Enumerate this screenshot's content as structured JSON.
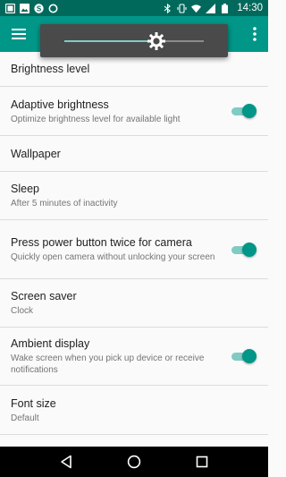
{
  "status_bar": {
    "time": "14:30",
    "left_icons": [
      "notification-icon",
      "image-icon",
      "skype-icon",
      "sync-icon"
    ],
    "right_icons": [
      "bluetooth-icon",
      "vibrate-icon",
      "wifi-icon",
      "cellular-icon",
      "battery-icon"
    ]
  },
  "toolbar": {
    "color": "#009688",
    "menu_icon": "hamburger-menu-icon",
    "overflow_icon": "more-vert-icon"
  },
  "brightness_slider": {
    "level": 0.66,
    "icon": "brightness-icon"
  },
  "settings": [
    {
      "title": "Brightness level",
      "summary": "",
      "toggle": null
    },
    {
      "title": "Adaptive brightness",
      "summary": "Optimize brightness level for available light",
      "toggle": true
    },
    {
      "title": "Wallpaper",
      "summary": "",
      "toggle": null
    },
    {
      "title": "Sleep",
      "summary": "After 5 minutes of inactivity",
      "toggle": null
    },
    {
      "title": "Press power button twice for camera",
      "summary": "Quickly open camera without unlocking your screen",
      "toggle": true
    },
    {
      "title": "Screen saver",
      "summary": "Clock",
      "toggle": null
    },
    {
      "title": "Ambient display",
      "summary": "Wake screen when you pick up device or receive notifications",
      "toggle": true
    },
    {
      "title": "Font size",
      "summary": "Default",
      "toggle": null
    }
  ],
  "nav_bar": {
    "back_icon": "back-icon",
    "home_icon": "home-icon",
    "recents_icon": "recents-icon"
  },
  "colors": {
    "accent": "#009688",
    "status_bar": "#00695c",
    "toggle_track": "#80cbc4"
  }
}
